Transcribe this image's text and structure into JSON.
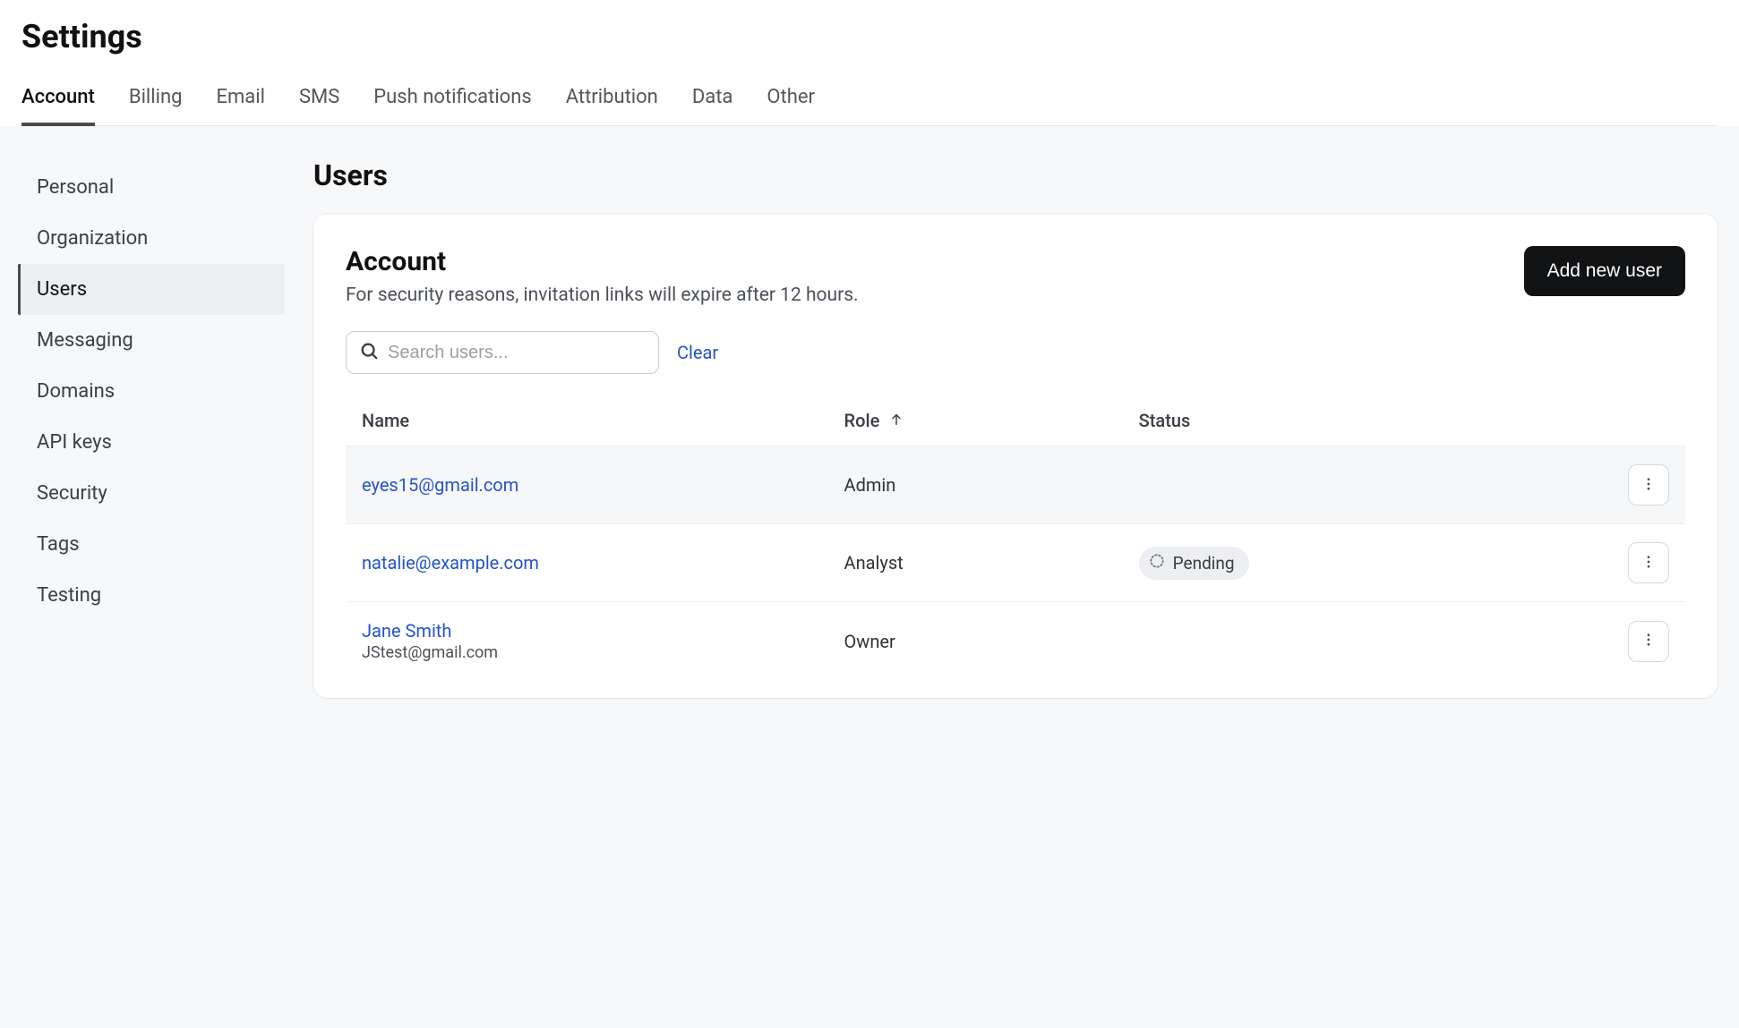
{
  "page": {
    "title": "Settings"
  },
  "tabs": [
    {
      "id": "account",
      "label": "Account",
      "active": true
    },
    {
      "id": "billing",
      "label": "Billing",
      "active": false
    },
    {
      "id": "email",
      "label": "Email",
      "active": false
    },
    {
      "id": "sms",
      "label": "SMS",
      "active": false
    },
    {
      "id": "push",
      "label": "Push notifications",
      "active": false
    },
    {
      "id": "attribution",
      "label": "Attribution",
      "active": false
    },
    {
      "id": "data",
      "label": "Data",
      "active": false
    },
    {
      "id": "other",
      "label": "Other",
      "active": false
    }
  ],
  "sidebar": {
    "items": [
      {
        "id": "personal",
        "label": "Personal",
        "active": false
      },
      {
        "id": "organization",
        "label": "Organization",
        "active": false
      },
      {
        "id": "users",
        "label": "Users",
        "active": true
      },
      {
        "id": "messaging",
        "label": "Messaging",
        "active": false
      },
      {
        "id": "domains",
        "label": "Domains",
        "active": false
      },
      {
        "id": "api-keys",
        "label": "API keys",
        "active": false
      },
      {
        "id": "security",
        "label": "Security",
        "active": false
      },
      {
        "id": "tags",
        "label": "Tags",
        "active": false
      },
      {
        "id": "testing",
        "label": "Testing",
        "active": false
      }
    ]
  },
  "main": {
    "title": "Users",
    "card": {
      "title": "Account",
      "subtitle": "For security reasons, invitation links will expire after 12 hours.",
      "add_button_label": "Add new user",
      "search": {
        "placeholder": "Search users...",
        "value": "",
        "clear_label": "Clear"
      },
      "table": {
        "columns": {
          "name": "Name",
          "role": "Role",
          "role_sort_dir": "asc",
          "status": "Status"
        },
        "rows": [
          {
            "primary": "eyes15@gmail.com",
            "secondary": "",
            "role": "Admin",
            "status": ""
          },
          {
            "primary": "natalie@example.com",
            "secondary": "",
            "role": "Analyst",
            "status": "Pending"
          },
          {
            "primary": "Jane Smith",
            "secondary": "JStest@gmail.com",
            "role": "Owner",
            "status": ""
          }
        ]
      }
    }
  }
}
